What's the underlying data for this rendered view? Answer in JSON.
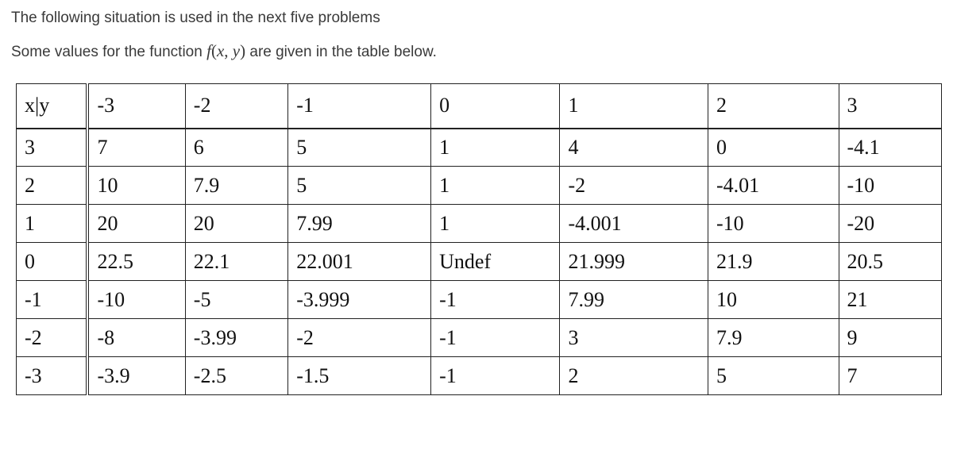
{
  "intro": "The following situation is used in the next five problems",
  "function_sentence_before": "Some values for the function ",
  "function_sentence_after": " are given in the table below.",
  "function_expr_f": "f",
  "function_expr_open": "(",
  "function_expr_x": "x",
  "function_expr_comma": ", ",
  "function_expr_y": "y",
  "function_expr_close": ")",
  "table": {
    "corner": "x|y",
    "col_headers": [
      "-3",
      "-2",
      "-1",
      "0",
      "1",
      "2",
      "3"
    ],
    "rows": [
      {
        "label": "3",
        "cells": [
          "7",
          "6",
          "5",
          "1",
          "4",
          "0",
          "-4.1"
        ]
      },
      {
        "label": "2",
        "cells": [
          "10",
          "7.9",
          "5",
          "1",
          "-2",
          "-4.01",
          "-10"
        ]
      },
      {
        "label": "1",
        "cells": [
          "20",
          "20",
          "7.99",
          "1",
          "-4.001",
          "-10",
          "-20"
        ]
      },
      {
        "label": "0",
        "cells": [
          "22.5",
          "22.1",
          "22.001",
          "Undef",
          "21.999",
          "21.9",
          "20.5"
        ]
      },
      {
        "label": "-1",
        "cells": [
          "-10",
          "-5",
          "-3.999",
          "-1",
          "7.99",
          "10",
          "21"
        ]
      },
      {
        "label": "-2",
        "cells": [
          "-8",
          "-3.99",
          "-2",
          "-1",
          "3",
          "7.9",
          "9"
        ]
      },
      {
        "label": "-3",
        "cells": [
          "-3.9",
          "-2.5",
          "-1.5",
          "-1",
          "2",
          "5",
          "7"
        ]
      }
    ]
  }
}
